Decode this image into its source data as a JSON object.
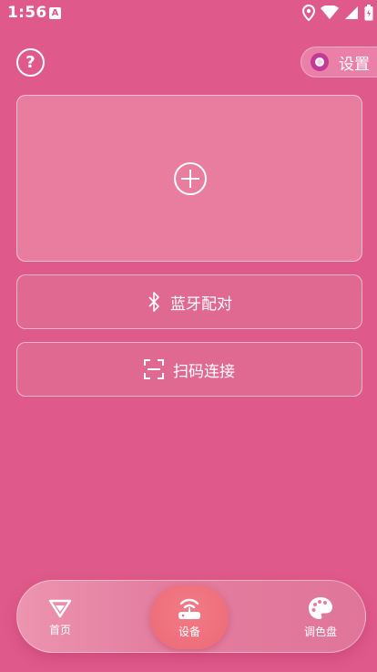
{
  "status_bar": {
    "time": "1:56",
    "notif_letter": "A"
  },
  "header": {
    "settings_label": "设置"
  },
  "actions": {
    "bluetooth_label": "蓝牙配对",
    "scan_label": "扫码连接"
  },
  "bottom_nav": {
    "items": [
      {
        "label": "首页",
        "icon": "home-diamond-icon"
      },
      {
        "label": "设备",
        "icon": "router-icon"
      },
      {
        "label": "调色盘",
        "icon": "palette-icon"
      }
    ],
    "selected": "设备"
  },
  "colors": {
    "background": "#df5a8a",
    "card": "#e87d9f",
    "active_tab": "#ed6a78"
  }
}
